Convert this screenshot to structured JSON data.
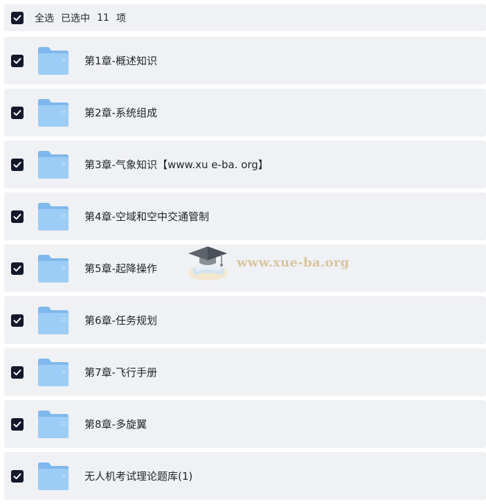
{
  "header": {
    "select_all_label": "全选",
    "selected_prefix": "已选中",
    "selected_count": "11",
    "selected_unit": "项"
  },
  "items": [
    {
      "label": "第1章-概述知识",
      "checked": true
    },
    {
      "label": "第2章-系统组成",
      "checked": true
    },
    {
      "label": "第3章-气象知识【www.xu e-ba. org】",
      "checked": true
    },
    {
      "label": "第4章-空域和空中交通管制",
      "checked": true
    },
    {
      "label": "第5章-起降操作",
      "checked": true
    },
    {
      "label": "第6章-任务规划",
      "checked": true
    },
    {
      "label": "第7章-飞行手册",
      "checked": true
    },
    {
      "label": "第8章-多旋翼",
      "checked": true
    },
    {
      "label": "无人机考试理论题库(1)",
      "checked": true
    }
  ],
  "watermark": {
    "text": "www.xue-ba.org"
  },
  "colors": {
    "checkbox_bg": "#14182b",
    "row_bg": "#f0f1f4",
    "folder_blue": "#8ec4f3",
    "watermark_text": "#d6c39a"
  },
  "icons": {
    "checkbox": "checkmark-icon",
    "folder": "folder-icon",
    "watermark": "graduation-cap-icon"
  }
}
